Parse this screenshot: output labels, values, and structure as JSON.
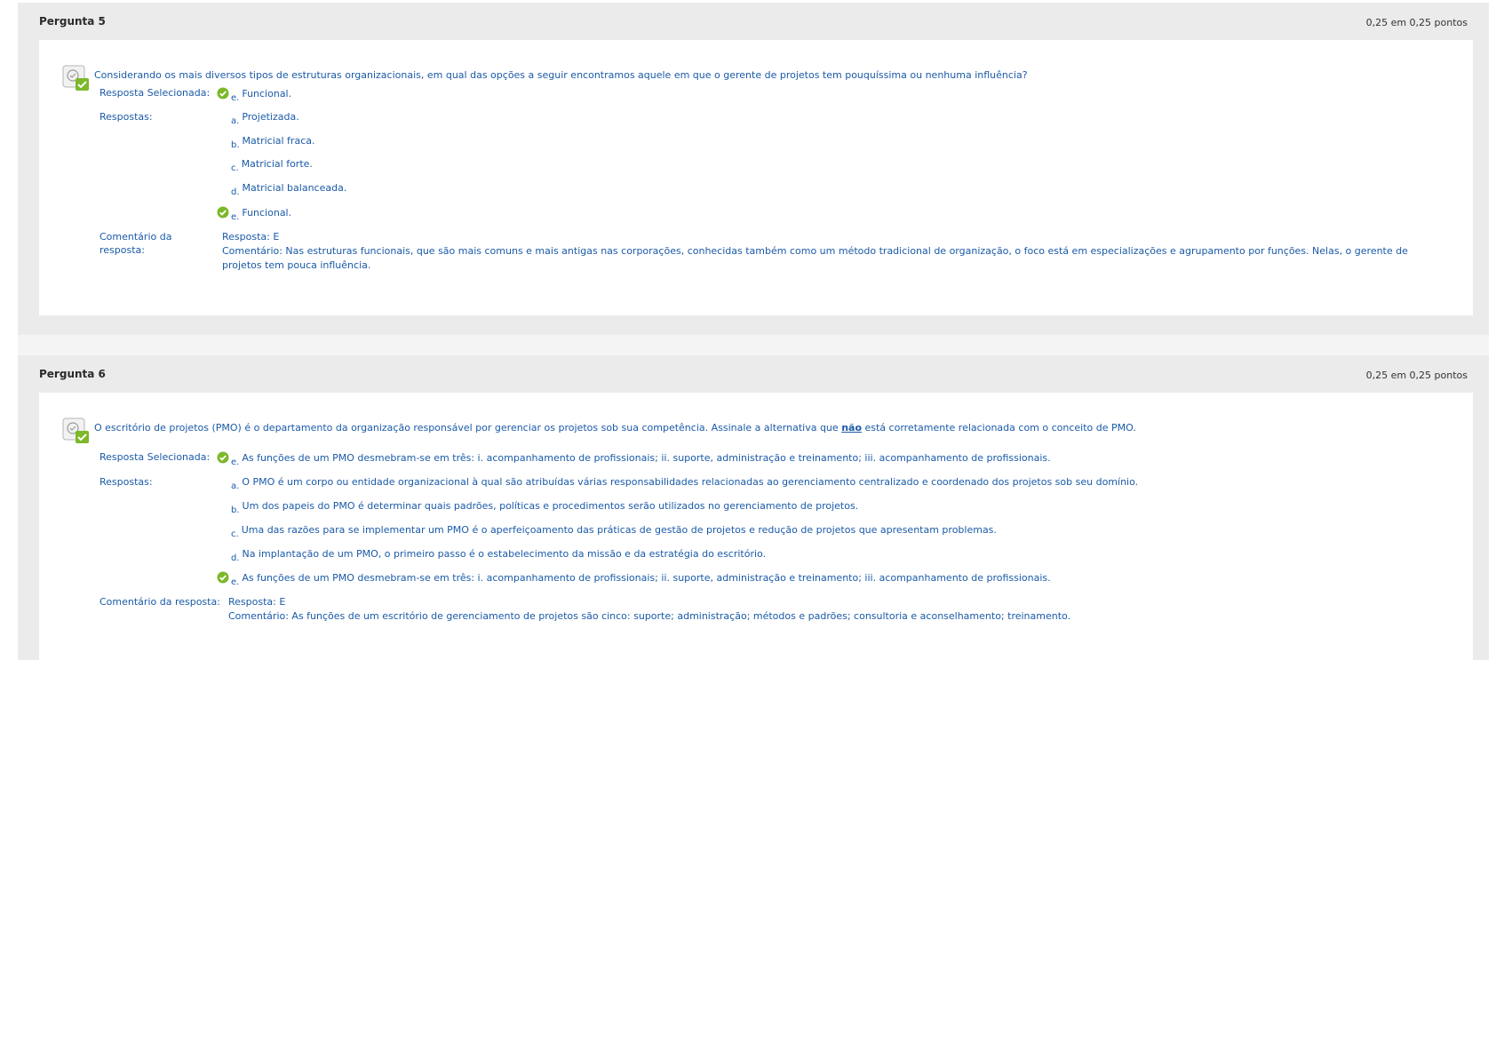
{
  "q5": {
    "title": "Pergunta 5",
    "points": "0,25 em 0,25 pontos",
    "text": "Considerando os mais diversos tipos de estruturas organizacionais, em qual das opções a seguir encontramos aquele em que o gerente de projetos tem pouquíssima ou nenhuma influência?",
    "selected_label": "Resposta Selecionada:",
    "selected_letter": "e.",
    "selected_text": "Funcional.",
    "answers_label": "Respostas:",
    "answers": [
      {
        "letter": "a.",
        "text": "Projetizada."
      },
      {
        "letter": "b.",
        "text": "Matricial fraca."
      },
      {
        "letter": "c.",
        "text": "Matricial forte."
      },
      {
        "letter": "d.",
        "text": "Matricial balanceada."
      },
      {
        "letter": "e.",
        "text": "Funcional."
      }
    ],
    "comment_label_1": "Comentário da",
    "comment_label_2": "resposta:",
    "comment_answer": "Resposta: E",
    "comment_line1": "Comentário: Nas estruturas funcionais, que são mais comuns e mais antigas nas corporações, conhecidas também como um método tradicional de organização, o foco está em especializações e agrupamento por funções. Nelas, o gerente de",
    "comment_line2": "projetos tem pouca influência."
  },
  "q6": {
    "title": "Pergunta 6",
    "points": "0,25 em 0,25 pontos",
    "text_before": "O escritório de projetos (PMO) é o departamento da organização responsável por gerenciar os projetos sob sua competência. Assinale a alternativa que ",
    "text_emphasis": "não",
    "text_after": " está corretamente relacionada com o conceito de PMO.",
    "selected_label": "Resposta Selecionada:",
    "selected_letter": "e.",
    "selected_text": "As funções de um PMO desmebram-se em três: i. acompanhamento de profissionais; ii. suporte, administração e treinamento; iii. acompanhamento de profissionais.",
    "answers_label": "Respostas:",
    "answers": [
      {
        "letter": "a.",
        "text": "O PMO é um corpo ou entidade organizacional à qual são atribuídas várias responsabilidades relacionadas ao gerenciamento centralizado e coordenado dos projetos sob seu domínio."
      },
      {
        "letter": "b.",
        "text": "Um dos papeis do PMO é determinar quais padrões, políticas e procedimentos serão utilizados no gerenciamento de projetos."
      },
      {
        "letter": "c.",
        "text": "Uma das razões para se implementar um PMO é o aperfeiçoamento das práticas de gestão de projetos e redução de projetos que apresentam problemas."
      },
      {
        "letter": "d.",
        "text": "Na implantação de um PMO, o primeiro passo é o estabelecimento da missão e da estratégia do escritório."
      },
      {
        "letter": "e.",
        "text": "As funções de um PMO desmebram-se em três: i. acompanhamento de profissionais; ii. suporte, administração e treinamento; iii. acompanhamento de profissionais."
      }
    ],
    "comment_label": "Comentário da resposta:",
    "comment_answer": "Resposta: E",
    "comment_line1": "Comentário: As funções de um escritório de gerenciamento de projetos são cinco: suporte; administração; métodos e padrões; consultoria e aconselhamento; treinamento."
  },
  "colors": {
    "text": "#1a5aa8",
    "check": "#7cb829",
    "header_bg": "#ebebeb"
  },
  "icons": {
    "status": "graded-correct-icon",
    "check": "correct-check-icon"
  }
}
